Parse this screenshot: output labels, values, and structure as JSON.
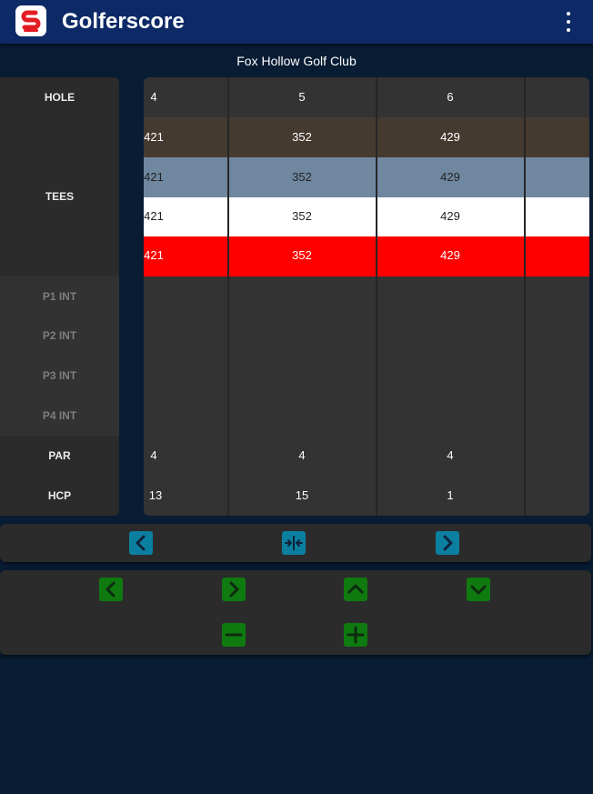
{
  "app": {
    "title": "Golferscore"
  },
  "course": {
    "name": "Fox Hollow Golf Club"
  },
  "labels": {
    "hole": "HOLE",
    "tees": "TEES",
    "players": [
      "P1 INT",
      "P2 INT",
      "P3 INT",
      "P4 INT"
    ],
    "par": "PAR",
    "hcp": "HCP"
  },
  "holes": [
    {
      "number": "4",
      "tees": [
        "421",
        "421",
        "421",
        "421"
      ],
      "par": "4",
      "hcp": "13"
    },
    {
      "number": "5",
      "tees": [
        "352",
        "352",
        "352",
        "352"
      ],
      "par": "4",
      "hcp": "15"
    },
    {
      "number": "6",
      "tees": [
        "429",
        "429",
        "429",
        "429"
      ],
      "par": "4",
      "hcp": "1"
    }
  ],
  "tee_colors": [
    "#453a30",
    "#6f879f",
    "#ffffff",
    "#ff0000"
  ],
  "tee_text_colors": [
    "#ffffff",
    "#222222",
    "#222222",
    "#ffffff"
  ],
  "icons": {
    "logo": "golferscore-logo-icon",
    "menu": "more-vert-icon",
    "scroll_prev": "chevron-left-icon",
    "fit": "collapse-horizontal-icon",
    "scroll_next": "chevron-right-icon",
    "move_left": "chevron-left-icon",
    "move_right": "chevron-right-icon",
    "move_up": "chevron-up-icon",
    "move_down": "chevron-down-icon",
    "decrement": "minus-icon",
    "increment": "plus-icon"
  },
  "colors": {
    "appbar": "#0d2a66",
    "background": "#081c33",
    "blue_button": "#0b7fa0",
    "green_button": "#0f7a0f"
  }
}
